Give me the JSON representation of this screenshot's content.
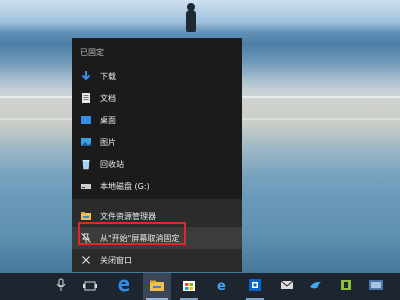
{
  "jump_list": {
    "pinned_header": "已固定",
    "pinned_items": [
      {
        "label": "下载",
        "icon": "download-arrow-icon"
      },
      {
        "label": "文档",
        "icon": "document-icon"
      },
      {
        "label": "桌面",
        "icon": "desktop-icon"
      },
      {
        "label": "图片",
        "icon": "pictures-icon"
      },
      {
        "label": "回收站",
        "icon": "recycle-bin-icon"
      },
      {
        "label": "本地磁盘 (G:)",
        "icon": "drive-icon"
      }
    ],
    "actions": [
      {
        "label": "文件资源管理器",
        "icon": "file-explorer-icon"
      },
      {
        "label": "从\"开始\"屏幕取消固定",
        "icon": "unpin-icon"
      },
      {
        "label": "关闭窗口",
        "icon": "close-icon"
      }
    ]
  },
  "taskbar": {
    "items": [
      "microphone-icon",
      "task-view-icon",
      "edge-icon",
      "file-explorer-icon",
      "store-icon",
      "ie-icon",
      "outlook-icon",
      "mail-app-icon",
      "bird-app-icon",
      "mobile-app-icon",
      "misc-app-icon"
    ]
  },
  "colors": {
    "highlight_box": "#e0262b",
    "menu_bg": "#1b1b1b",
    "accent_blue": "#1e88e5"
  }
}
